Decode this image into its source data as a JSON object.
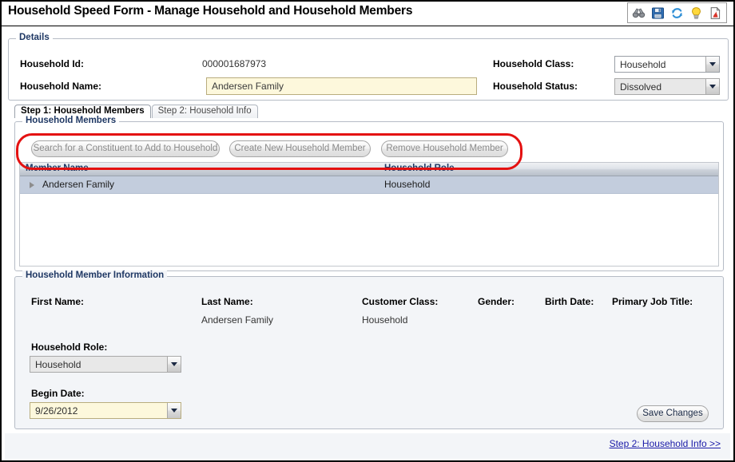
{
  "window": {
    "title": "Household Speed Form - Manage Household and Household Members"
  },
  "toolbar": {
    "icons": [
      {
        "name": "binoculars-icon",
        "label": "Search"
      },
      {
        "name": "save-icon",
        "label": "Save"
      },
      {
        "name": "refresh-icon",
        "label": "Refresh"
      },
      {
        "name": "lightbulb-icon",
        "label": "Hint"
      },
      {
        "name": "report-icon",
        "label": "Report"
      }
    ]
  },
  "details": {
    "legend": "Details",
    "household_id_label": "Household Id:",
    "household_id_value": "000001687973",
    "household_name_label": "Household Name:",
    "household_name_value": "Andersen Family",
    "household_class_label": "Household Class:",
    "household_class_value": "Household",
    "household_status_label": "Household Status:",
    "household_status_value": "Dissolved"
  },
  "tabs": [
    {
      "label": "Step 1: Household Members",
      "active": true
    },
    {
      "label": "Step 2: Household Info",
      "active": false
    }
  ],
  "members": {
    "legend": "Household Members",
    "buttons": [
      {
        "name": "search-constituent-button",
        "label": "Search for a Constituent to Add to Household"
      },
      {
        "name": "create-new-household-member-button",
        "label": "Create New Household Member"
      },
      {
        "name": "remove-household-member-button",
        "label": "Remove Household Member"
      }
    ],
    "columns": [
      "Member Name",
      "Household Role"
    ],
    "rows": [
      {
        "member_name": "Andersen Family",
        "household_role": "Household"
      }
    ]
  },
  "member_info": {
    "legend": "Household Member Information",
    "first_name_label": "First Name:",
    "first_name_value": "",
    "last_name_label": "Last Name:",
    "last_name_value": "Andersen Family",
    "customer_class_label": "Customer Class:",
    "customer_class_value": "Household",
    "gender_label": "Gender:",
    "gender_value": "",
    "birth_date_label": "Birth Date:",
    "birth_date_value": "",
    "primary_job_title_label": "Primary Job Title:",
    "primary_job_title_value": "",
    "household_role_label": "Household Role:",
    "household_role_value": "Household",
    "begin_date_label": "Begin Date:",
    "begin_date_value": "9/26/2012",
    "save_changes_label": "Save Changes"
  },
  "footer": {
    "next_step_link": "Step 2: Household Info >>"
  },
  "colors": {
    "annotation": "#e41111",
    "legend_text": "#1f3864",
    "link": "#1a1aa8",
    "required_field": "#fdf8dc",
    "selected_row": "#c3cddd"
  }
}
